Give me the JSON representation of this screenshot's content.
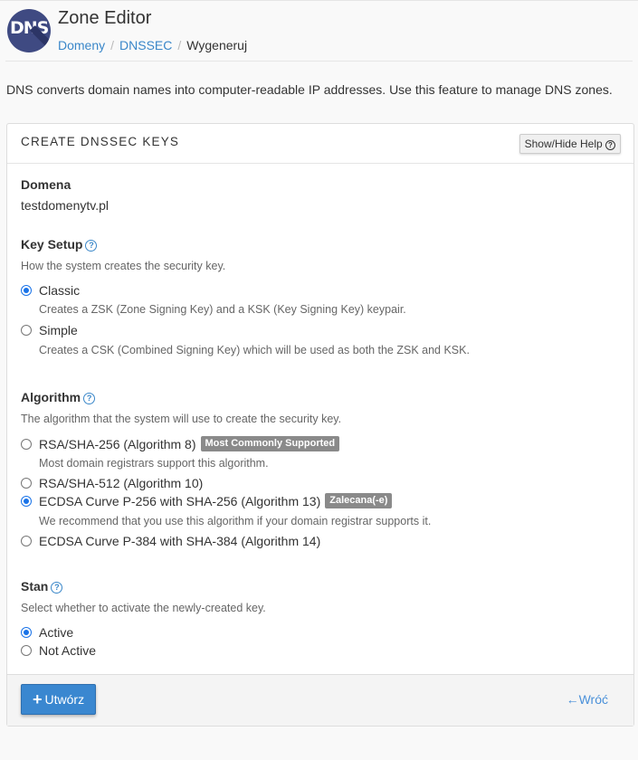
{
  "header": {
    "logo_text": "DNS",
    "title": "Zone Editor",
    "breadcrumb": [
      {
        "label": "Domeny"
      },
      {
        "label": "DNSSEC"
      },
      {
        "label": "Wygeneruj"
      }
    ]
  },
  "intro": "DNS converts domain names into computer-readable IP addresses. Use this feature to manage DNS zones.",
  "panel": {
    "title": "CREATE DNSSEC KEYS",
    "help_button": "Show/Hide Help",
    "domain": {
      "label": "Domena",
      "value": "testdomenytv.pl"
    },
    "key_setup": {
      "label": "Key Setup",
      "hint": "How the system creates the security key.",
      "options": [
        {
          "label": "Classic",
          "desc": "Creates a ZSK (Zone Signing Key) and a KSK (Key Signing Key) keypair.",
          "selected": true
        },
        {
          "label": "Simple",
          "desc": "Creates a CSK (Combined Signing Key) which will be used as both the ZSK and KSK.",
          "selected": false
        }
      ]
    },
    "algorithm": {
      "label": "Algorithm",
      "hint": "The algorithm that the system will use to create the security key.",
      "options": [
        {
          "label": "RSA/SHA-256 (Algorithm 8)",
          "badge": "Most Commonly Supported",
          "desc": "Most domain registrars support this algorithm.",
          "selected": false
        },
        {
          "label": "RSA/SHA-512 (Algorithm 10)",
          "selected": false
        },
        {
          "label": "ECDSA Curve P-256 with SHA-256 (Algorithm 13)",
          "badge": "Zalecana(-e)",
          "desc": "We recommend that you use this algorithm if your domain registrar supports it.",
          "selected": true
        },
        {
          "label": "ECDSA Curve P-384 with SHA-384 (Algorithm 14)",
          "selected": false
        }
      ]
    },
    "state": {
      "label": "Stan",
      "hint": "Select whether to activate the newly-created key.",
      "options": [
        {
          "label": "Active",
          "selected": true
        },
        {
          "label": "Not Active",
          "selected": false
        }
      ]
    },
    "footer": {
      "create_button": "Utwórz",
      "back_link": "Wróć"
    }
  },
  "colors": {
    "accent": "#3a87d0",
    "link": "#3a87c9",
    "badge": "#8a8a8a",
    "radio": "#1a73e8"
  }
}
